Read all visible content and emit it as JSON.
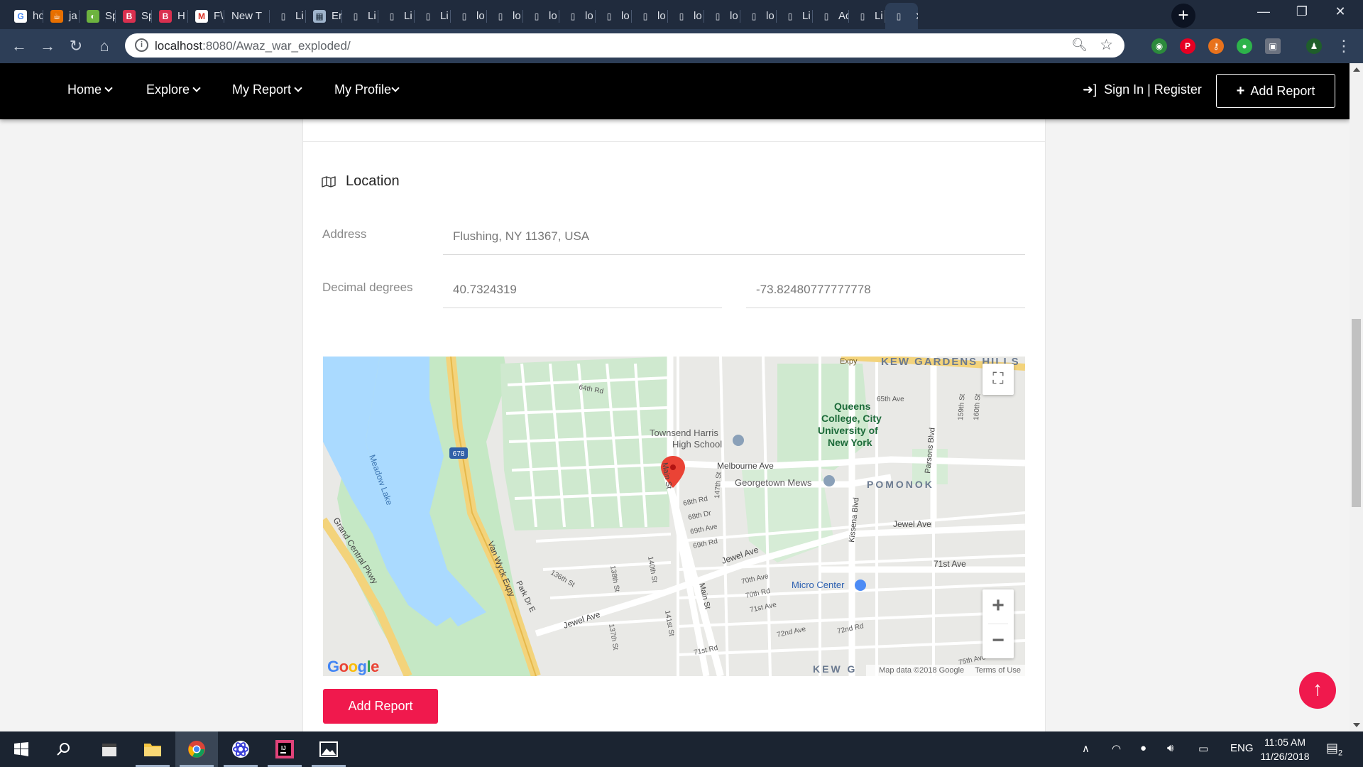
{
  "browser": {
    "tabs": [
      {
        "label": "hc",
        "icon": "google-icon"
      },
      {
        "label": "ja",
        "icon": "java-icon"
      },
      {
        "label": "Sp",
        "icon": "spring-icon"
      },
      {
        "label": "Sp",
        "icon": "bootstrap-icon"
      },
      {
        "label": "H",
        "icon": "bootstrap-icon"
      },
      {
        "label": "F\\",
        "icon": "gmail-icon"
      },
      {
        "label": "New T",
        "icon": ""
      },
      {
        "label": "Li",
        "icon": "page-icon"
      },
      {
        "label": "Er",
        "icon": "image-icon"
      },
      {
        "label": "Li",
        "icon": "page-icon"
      },
      {
        "label": "Li",
        "icon": "page-icon"
      },
      {
        "label": "Li",
        "icon": "page-icon"
      },
      {
        "label": "lo",
        "icon": "page-icon"
      },
      {
        "label": "lo",
        "icon": "page-icon"
      },
      {
        "label": "lo",
        "icon": "page-icon"
      },
      {
        "label": "lo",
        "icon": "page-icon"
      },
      {
        "label": "lo",
        "icon": "page-icon"
      },
      {
        "label": "lo",
        "icon": "page-icon"
      },
      {
        "label": "lo",
        "icon": "page-icon"
      },
      {
        "label": "lo",
        "icon": "page-icon"
      },
      {
        "label": "lo",
        "icon": "page-icon"
      },
      {
        "label": "Li",
        "icon": "page-icon"
      },
      {
        "label": "Ac",
        "icon": "page-icon"
      },
      {
        "label": "Li",
        "icon": "page-icon"
      },
      {
        "label": "",
        "icon": "page-icon"
      }
    ],
    "url_host": "localhost",
    "url_path": ":8080/Awaz_war_exploded/"
  },
  "nav": {
    "items": [
      "Home",
      "Explore",
      "My Report",
      "My Profile"
    ],
    "signin": "Sign In | Register",
    "add_report": "Add Report"
  },
  "location": {
    "title": "Location",
    "address_label": "Address",
    "address_value": "Flushing, NY 11367, USA",
    "decimal_label": "Decimal degrees",
    "latitude": "40.7324319",
    "longitude": "-73.82480777777778"
  },
  "map": {
    "labels": {
      "kew_gardens_hills": "KEW GARDENS HILLS",
      "qc": "Queens College, City University of New York",
      "townsend": "Townsend Harris High School",
      "melbourne": "Melbourne Ave",
      "georgetown": "Georgetown Mews",
      "pomonok": "POMONOK",
      "jewel_ave_e": "Jewel Ave",
      "jewel_ave_mid": "Jewel Ave",
      "jewel_ave_w": "Jewel Ave",
      "st71": "71st Ave",
      "micro": "Micro Center",
      "meadow_lake": "Meadow Lake",
      "grand_central": "Grand Central Pkwy",
      "van_wyck": "Van Wyck Expy",
      "park_dr": "Park Dr E",
      "main_st": "Main St",
      "kissena": "Kissena Blvd",
      "parsons": "Parsons Blvd",
      "rd64": "64th Rd",
      "ave65": "65th Ave",
      "rd68": "68th Rd",
      "dr68": "68th Dr",
      "ave69": "69th Ave",
      "rd69": "69th Rd",
      "ave70": "70th Ave",
      "rd70": "70th Rd",
      "ave71": "71st Ave",
      "rd71": "71st Rd",
      "ave72": "72nd Ave",
      "rd72": "72nd Rd",
      "ave75": "75th Ave",
      "st136": "136th St",
      "st137": "137th St",
      "st138": "138th St",
      "st140": "140th St",
      "st141": "141st St",
      "st147": "147th St",
      "st159": "159th St",
      "st160": "160th St",
      "kew_g": "KEW G",
      "i678": "678",
      "expy": "Expy"
    },
    "logo": "Google",
    "map_data": "Map data ©2018 Google",
    "terms": "Terms of Use"
  },
  "submit_label": "Add Report",
  "taskbar": {
    "lang": "ENG",
    "time": "11:05 AM",
    "date": "11/26/2018",
    "notif_count": "2"
  },
  "colors": {
    "accent": "#f0194d",
    "nav_bg": "#000000",
    "tabstrip_bg": "#202b3d",
    "water": "#aadaff",
    "park": "#c5e8c5"
  }
}
